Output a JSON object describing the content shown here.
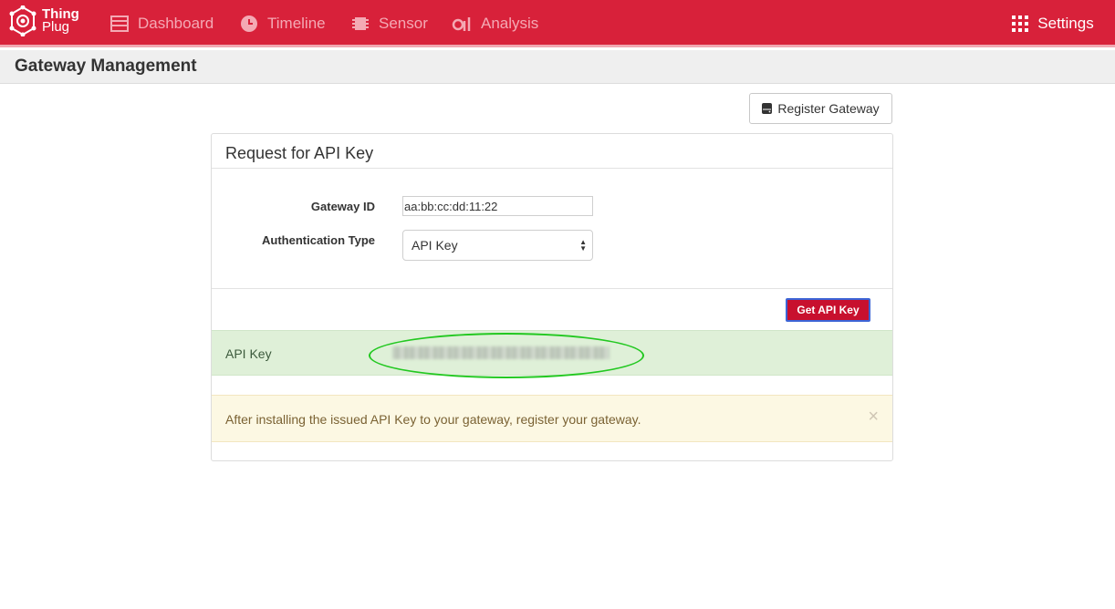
{
  "brand": {
    "line1": "Thing",
    "line2": "Plug"
  },
  "nav": {
    "items": [
      {
        "label": "Dashboard",
        "icon": "dashboard-icon"
      },
      {
        "label": "Timeline",
        "icon": "clock-icon"
      },
      {
        "label": "Sensor",
        "icon": "chip-icon"
      },
      {
        "label": "Analysis",
        "icon": "analysis-icon"
      }
    ],
    "settings": {
      "label": "Settings",
      "icon": "grid-icon"
    }
  },
  "page": {
    "title": "Gateway Management"
  },
  "toolbar": {
    "register_label": "Register Gateway",
    "register_icon": "server-icon"
  },
  "panel": {
    "title": "Request for API Key",
    "gateway_id": {
      "label": "Gateway ID",
      "value": "aa:bb:cc:dd:11:22"
    },
    "auth_type": {
      "label": "Authentication Type",
      "selected": "API Key"
    },
    "get_key_label": "Get API Key",
    "api_key": {
      "label": "API Key"
    },
    "warning": {
      "text": "After installing the issued API Key to your gateway, register your gateway.",
      "close": "×"
    }
  },
  "colors": {
    "brand": "#d8213a",
    "button": "#c8102e",
    "success_bg": "#dff0d8",
    "warning_bg": "#fcf8e3",
    "highlight": "#22c820"
  }
}
